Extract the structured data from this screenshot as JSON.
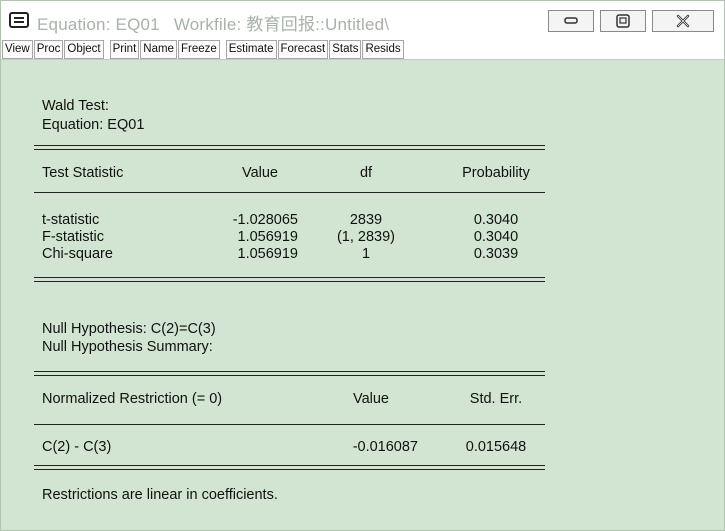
{
  "window": {
    "title_equation": "Equation: EQ01",
    "title_workfile": "Workfile: 教育回报::Untitled\\"
  },
  "toolbar": [
    "View",
    "Proc",
    "Object",
    "Print",
    "Name",
    "Freeze",
    "Estimate",
    "Forecast",
    "Stats",
    "Resids"
  ],
  "output": {
    "heading1": "Wald Test:",
    "heading2": "Equation: EQ01",
    "table1": {
      "headers": [
        "Test Statistic",
        "Value",
        "df",
        "Probability"
      ],
      "rows": [
        [
          "t-statistic",
          "-1.028065",
          "2839",
          "0.3040"
        ],
        [
          "F-statistic",
          "1.056919",
          "(1, 2839)",
          "0.3040"
        ],
        [
          "Chi-square",
          "1.056919",
          "1",
          "0.3039"
        ]
      ]
    },
    "null_hypothesis": "Null Hypothesis: C(2)=C(3)",
    "null_summary": "Null Hypothesis Summary:",
    "table2": {
      "headers": [
        "Normalized Restriction (= 0)",
        "Value",
        "Std. Err."
      ],
      "rows": [
        [
          "C(2) - C(3)",
          "-0.016087",
          "0.015648"
        ]
      ]
    },
    "footer": "Restrictions are linear in coefficients."
  }
}
